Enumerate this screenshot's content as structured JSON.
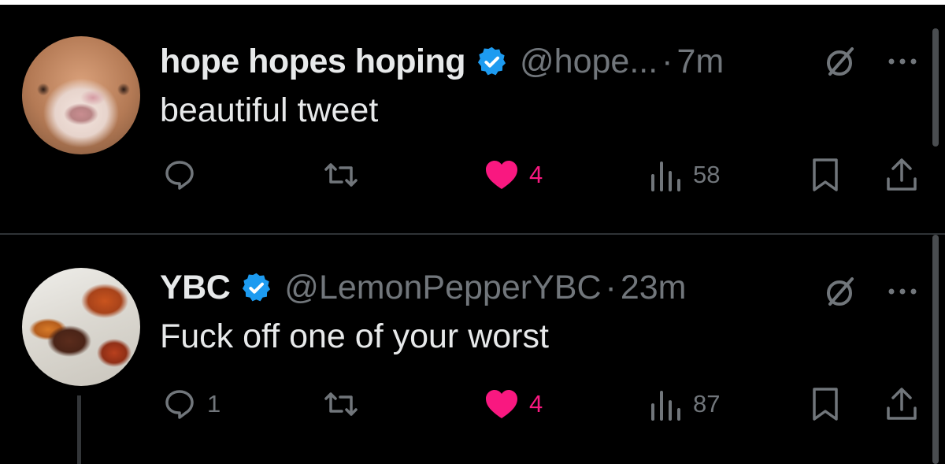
{
  "colors": {
    "background": "#000000",
    "text": "#e7e9ea",
    "muted": "#71767b",
    "like": "#f91880",
    "verified": "#1d9bf0"
  },
  "tweets": [
    {
      "name": "hope hopes hoping",
      "verified_icon": "verified-badge-icon",
      "handle": "@hope...",
      "dot": "·",
      "time": "7m",
      "text": "beautiful tweet",
      "actions": {
        "reply_count": "",
        "retweet_count": "",
        "like_count": "4",
        "views_count": "58"
      }
    },
    {
      "name": "YBC",
      "verified_icon": "verified-badge-icon",
      "handle": "@LemonPepperYBC",
      "dot": "·",
      "time": "23m",
      "text": "Fuck off one of your worst",
      "actions": {
        "reply_count": "1",
        "retweet_count": "",
        "like_count": "4",
        "views_count": "87"
      }
    }
  ]
}
